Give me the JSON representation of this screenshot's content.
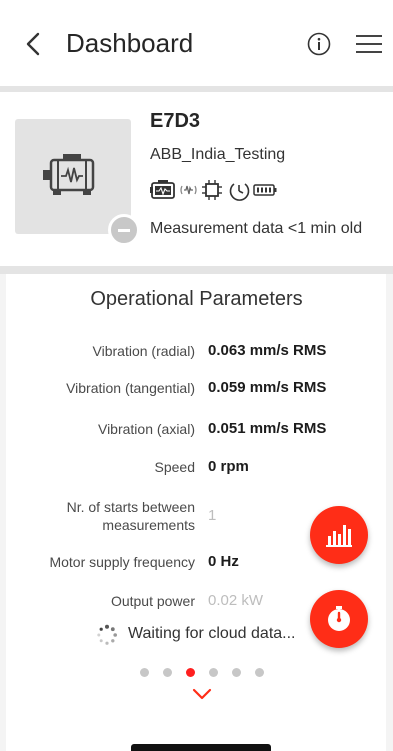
{
  "header": {
    "title": "Dashboard"
  },
  "device": {
    "name": "E7D3",
    "organization": "ABB_India_Testing",
    "measurement_age": "Measurement data <1 min old",
    "status_icons": [
      "motor-icon",
      "vibration-icon",
      "chip-icon",
      "clock-icon",
      "battery-icon"
    ]
  },
  "section": {
    "title": "Operational Parameters",
    "params": [
      {
        "label": "Vibration (radial)",
        "value": "0.063 mm/s RMS"
      },
      {
        "label": "Vibration (tangential)",
        "value": "0.059 mm/s RMS"
      },
      {
        "label": "Vibration (axial)",
        "value": "0.051 mm/s RMS"
      },
      {
        "label": "Speed",
        "value": "0 rpm"
      },
      {
        "label_line1": "Nr. of starts between",
        "label_line2": "measurements",
        "value": "1"
      },
      {
        "label": "Motor supply frequency",
        "value": "0 Hz"
      },
      {
        "label": "Output power",
        "value": "0.02 kW"
      }
    ],
    "waiting": "Waiting for cloud data..."
  },
  "pager": {
    "count": 6,
    "active_index": 2
  },
  "colors": {
    "accent": "#ff2d17",
    "active_dot": "#ff1f1f"
  }
}
